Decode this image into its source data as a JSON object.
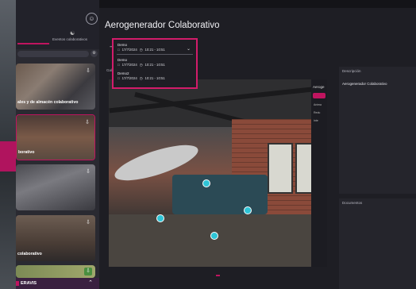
{
  "main": {
    "title": "Aerogenerador Colaborativo",
    "gallery_label": "Galería"
  },
  "sidebar": {
    "tab_right_label": "Eventos colaborativos",
    "cards": [
      {
        "label": "ales y de almacén colaborativo"
      },
      {
        "label": "borativo"
      },
      {
        "label": ""
      },
      {
        "label": "colaborativo"
      },
      {
        "label": ""
      }
    ],
    "bottom_label": "ERAVIS"
  },
  "session_selector": {
    "selected": {
      "name": "Demo",
      "date": "17/7/2024",
      "time": "10:21 - 10:51"
    },
    "options": [
      {
        "name": "Demo",
        "date": "17/7/2024",
        "time": "10:21 - 10:51"
      },
      {
        "name": "Demo2",
        "date": "17/7/2024",
        "time": "10:21 - 10:51"
      }
    ]
  },
  "viewer_panel": {
    "title": "Aeroge",
    "items": [
      "Anima",
      "Redu",
      "Inte"
    ]
  },
  "description": {
    "header": "Descripción",
    "text": "Aerogenerador Colaborativo"
  },
  "documents": {
    "header": "Documentos"
  },
  "colors": {
    "accent": "#c0145f",
    "hotspot": "#2ec4d6"
  }
}
